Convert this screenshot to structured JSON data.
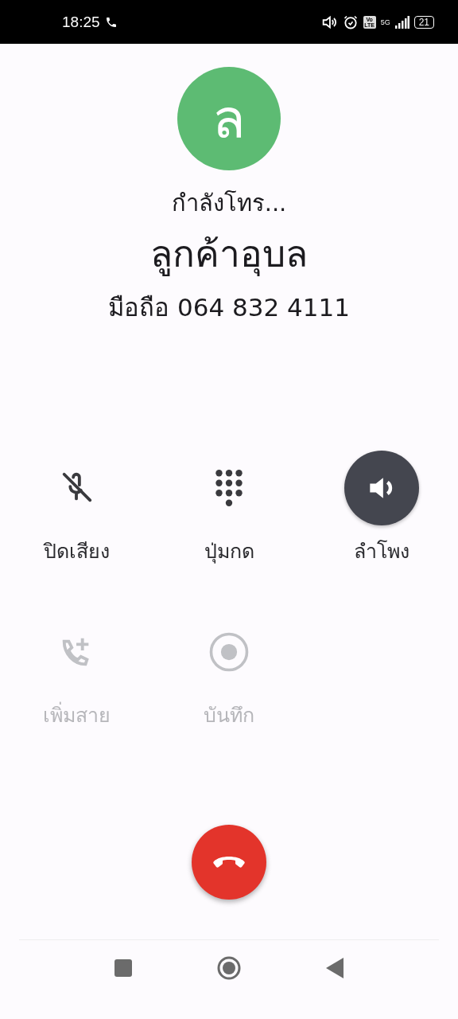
{
  "status_bar": {
    "time": "18:25",
    "volte": "Vo LTE",
    "network": "5G",
    "battery": "21"
  },
  "contact": {
    "avatar_letter": "ล",
    "status": "กำลังโทร...",
    "name": "ลูกค้าอุบล",
    "number": "มือถือ 064 832 4111"
  },
  "controls": [
    {
      "kind": "mute",
      "label": "ปิดเสียง",
      "selected": false,
      "disabled": false
    },
    {
      "kind": "keypad",
      "label": "ปุ่มกด",
      "selected": false,
      "disabled": false
    },
    {
      "kind": "speaker",
      "label": "ลำโพง",
      "selected": true,
      "disabled": false
    },
    {
      "kind": "add_call",
      "label": "เพิ่มสาย",
      "selected": false,
      "disabled": true
    },
    {
      "kind": "record",
      "label": "บันทึก",
      "selected": false,
      "disabled": true
    }
  ]
}
